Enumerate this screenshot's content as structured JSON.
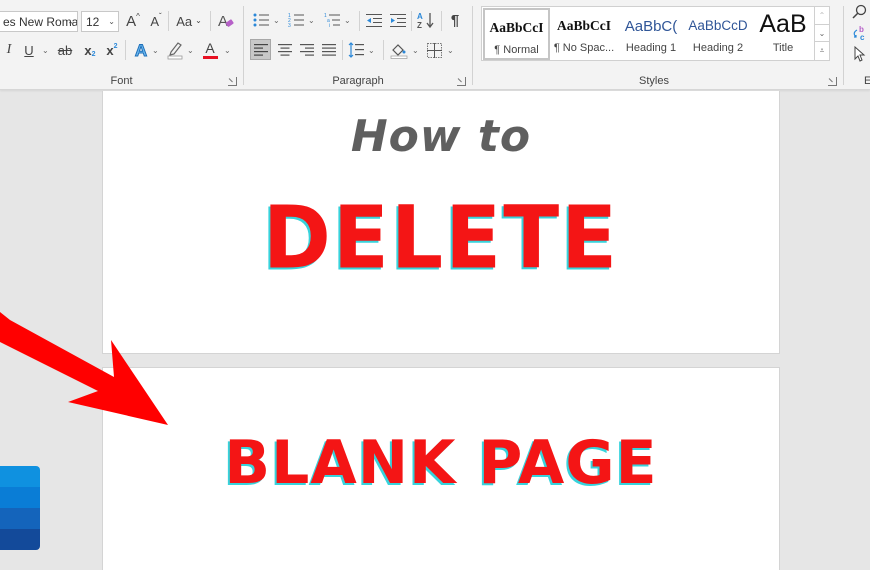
{
  "ribbon": {
    "font_group": {
      "label": "Font",
      "font_name": "es New Roma",
      "font_size": "12",
      "grow_font_label": "A",
      "shrink_font_label": "A",
      "change_case_label": "Aa",
      "italic_label": "I",
      "underline_label": "U",
      "strikethrough_label": "ab",
      "subscript_label": "x",
      "superscript_label": "x",
      "text_effects_label": "A",
      "font_color_label": "A",
      "font_color": "#e81123",
      "highlight_color": "#ffffff"
    },
    "paragraph_group": {
      "label": "Paragraph",
      "sort_label": "A↓",
      "pilcrow": "¶"
    },
    "styles_group": {
      "label": "Styles",
      "items": [
        {
          "sample": "AaBbCcI",
          "name": "¶ Normal",
          "selected": true
        },
        {
          "sample": "AaBbCcI",
          "name": "¶ No Spac...",
          "selected": false
        },
        {
          "sample": "AaBbC(",
          "name": "Heading 1",
          "selected": false
        },
        {
          "sample": "AaBbCcD",
          "name": "Heading 2",
          "selected": false
        },
        {
          "sample": "AaB",
          "name": "Title",
          "selected": false
        }
      ]
    },
    "editing_group": {
      "label": "E"
    }
  },
  "document": {
    "page1": {
      "line1": "How to",
      "line2": "DELETE"
    },
    "page2": {
      "line1": "BLANK PAGE"
    }
  },
  "colors": {
    "accent_red": "#f41515",
    "shadow_cyan": "#37d3dc",
    "heading_gray": "#5f5f5f",
    "word_blue": [
      "#0f91e0",
      "#0a78d0",
      "#1464bb",
      "#134a9a"
    ]
  }
}
